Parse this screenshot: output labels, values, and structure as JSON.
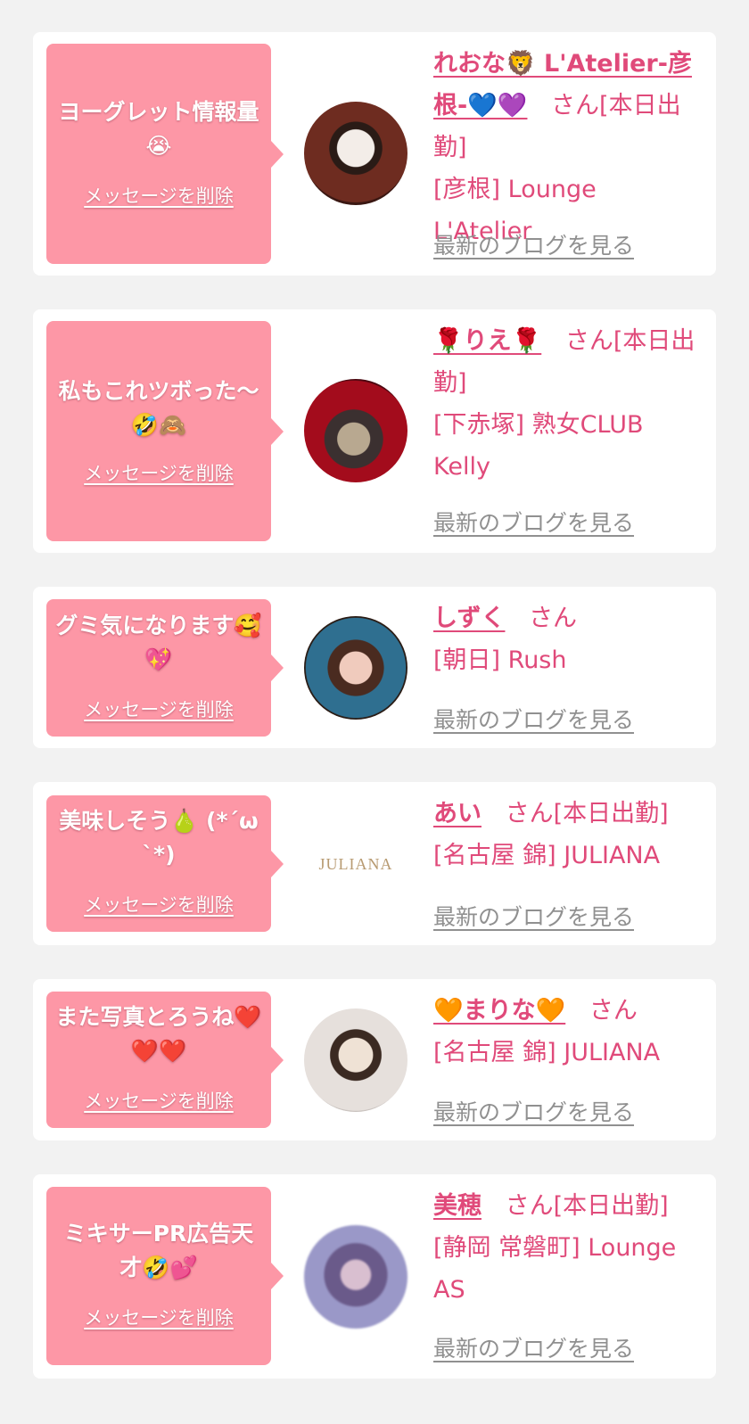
{
  "common": {
    "delete_label": "メッセージを削除",
    "blog_label": "最新のブログを見る",
    "san": "さん"
  },
  "colors": {
    "page_bg": "#f2f2f2",
    "card_bg": "#ffffff",
    "bubble_bg": "#fd97a6",
    "accent_pink": "#e04a7a",
    "link_gray": "#909090"
  },
  "items": [
    {
      "message": "ヨーグレット情報量😭",
      "name": "れおな🦁 L'Atelier-彦根-💙💜",
      "status": "[本日出勤]",
      "shop": "[彦根] Lounge L'Atelier",
      "avatar": "woman-photo"
    },
    {
      "message": "私もこれツボった〜🤣🙈",
      "name": "🌹りえ🌹",
      "status": "[本日出勤]",
      "shop": "[下赤塚] 熟女CLUB Kelly",
      "avatar": "woman-photo"
    },
    {
      "message": "グミ気になります🥰💖",
      "name": "しずく",
      "status": "",
      "shop": "[朝日] Rush",
      "avatar": "woman-photo"
    },
    {
      "message": "美味しそう🍐 (*´ω`*)",
      "name": "あい",
      "status": "[本日出勤]",
      "shop": "[名古屋 錦] JULIANA",
      "avatar": "shop-logo",
      "logo_text": "JULIANA"
    },
    {
      "message": "また写真とろうね❤️❤️❤️",
      "name": "🧡まりな🧡",
      "status": "",
      "shop": "[名古屋 錦] JULIANA",
      "avatar": "woman-photo"
    },
    {
      "message": "ミキサーPR広告天才🤣💕",
      "name": "美穂",
      "status": "[本日出勤]",
      "shop": "[静岡 常磐町] Lounge AS",
      "avatar": "woman-photo"
    }
  ]
}
